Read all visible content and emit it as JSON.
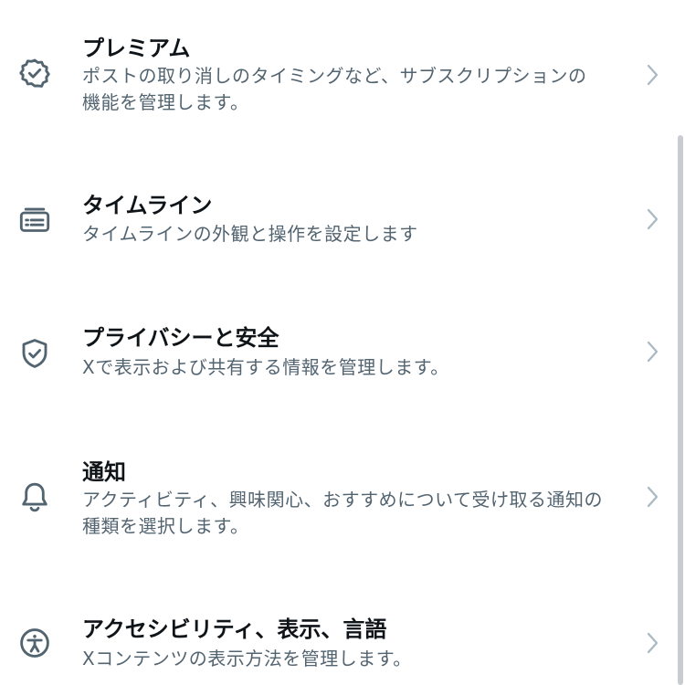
{
  "settings": {
    "items": [
      {
        "icon": "verified-badge-icon",
        "title": "プレミアム",
        "description": "ポストの取り消しのタイミングなど、サブスクリプションの機能を管理します。"
      },
      {
        "icon": "timeline-card-icon",
        "title": "タイムライン",
        "description": "タイムラインの外観と操作を設定します"
      },
      {
        "icon": "shield-check-icon",
        "title": "プライバシーと安全",
        "description": "Xで表示および共有する情報を管理します。"
      },
      {
        "icon": "bell-icon",
        "title": "通知",
        "description": "アクティビティ、興味関心、おすすめについて受け取る通知の種類を選択します。"
      },
      {
        "icon": "accessibility-icon",
        "title": "アクセシビリティ、表示、言語",
        "description": "Xコンテンツの表示方法を管理します。"
      }
    ]
  },
  "colors": {
    "title": "#0f1419",
    "secondary_text": "#536471",
    "chevron": "#aab8c2",
    "scrollbar": "#c9ccd0"
  }
}
